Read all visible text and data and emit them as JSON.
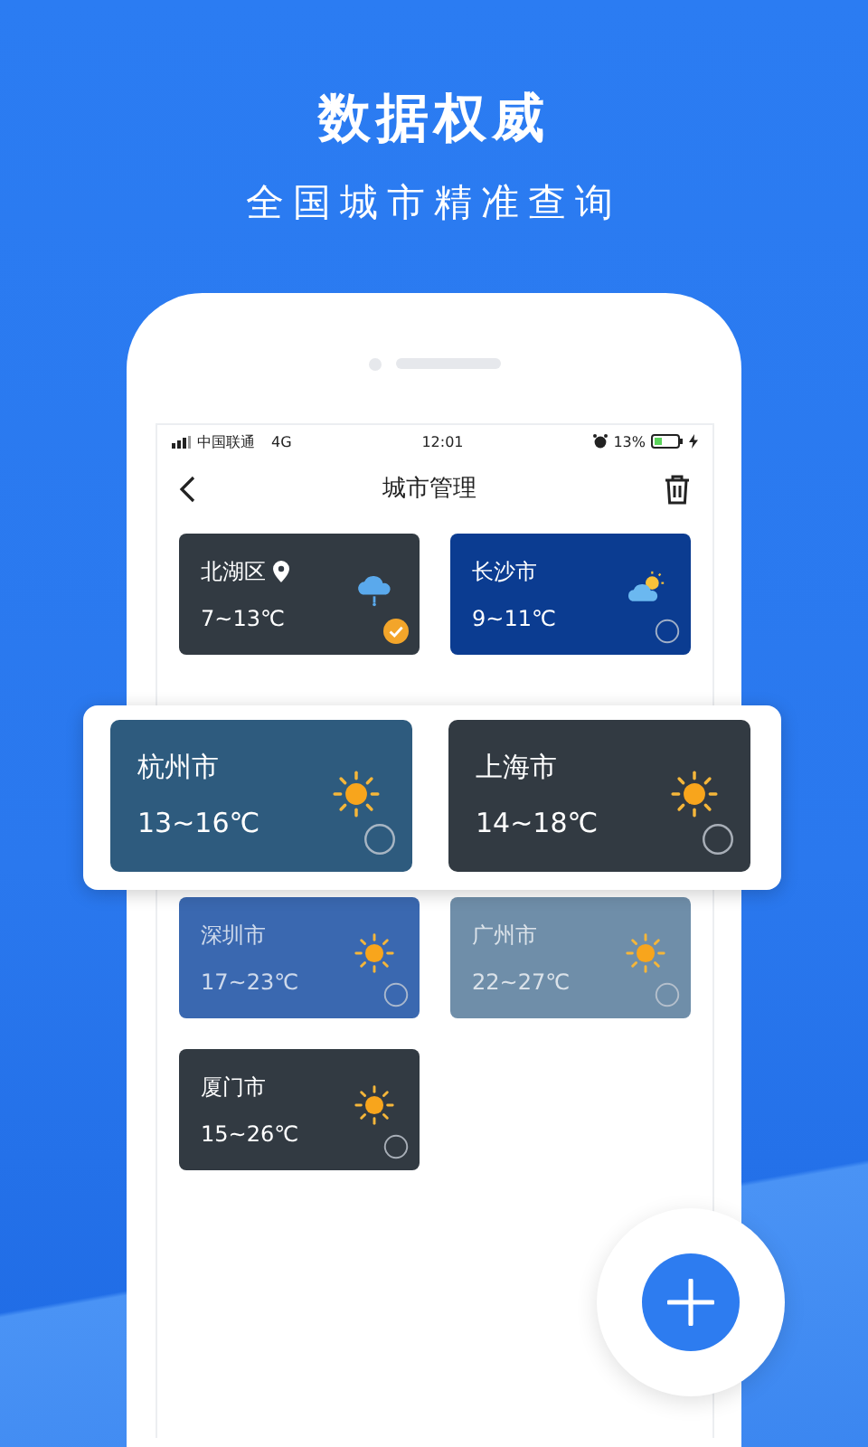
{
  "headline": "数据权威",
  "subheadline": "全国城市精准查询",
  "status_bar": {
    "carrier": "中国联通",
    "network": "4G",
    "time": "12:01",
    "battery": "13%"
  },
  "header": {
    "title": "城市管理"
  },
  "cities": [
    {
      "name": "北湖区",
      "temp": "7~13℃",
      "kind": "rain",
      "location": true,
      "selected": true,
      "color": "#323a42"
    },
    {
      "name": "长沙市",
      "temp": "9~11℃",
      "kind": "partly_cloudy",
      "location": false,
      "selected": false,
      "color": "#0b3c91"
    },
    {
      "name": "深圳市",
      "temp": "17~23℃",
      "kind": "sunny",
      "location": false,
      "selected": false,
      "color": "#3a68b0"
    },
    {
      "name": "广州市",
      "temp": "22~27℃",
      "kind": "sunny",
      "location": false,
      "selected": false,
      "color": "#6f8ea9"
    },
    {
      "name": "厦门市",
      "temp": "15~26℃",
      "kind": "sunny",
      "location": false,
      "selected": false,
      "color": "#323a42"
    }
  ],
  "highlight": [
    {
      "name": "杭州市",
      "temp": "13~16℃",
      "kind": "sunny",
      "selected": false,
      "color": "#2e5b7e"
    },
    {
      "name": "上海市",
      "temp": "14~18℃",
      "kind": "sunny",
      "selected": false,
      "color": "#323a42"
    }
  ]
}
